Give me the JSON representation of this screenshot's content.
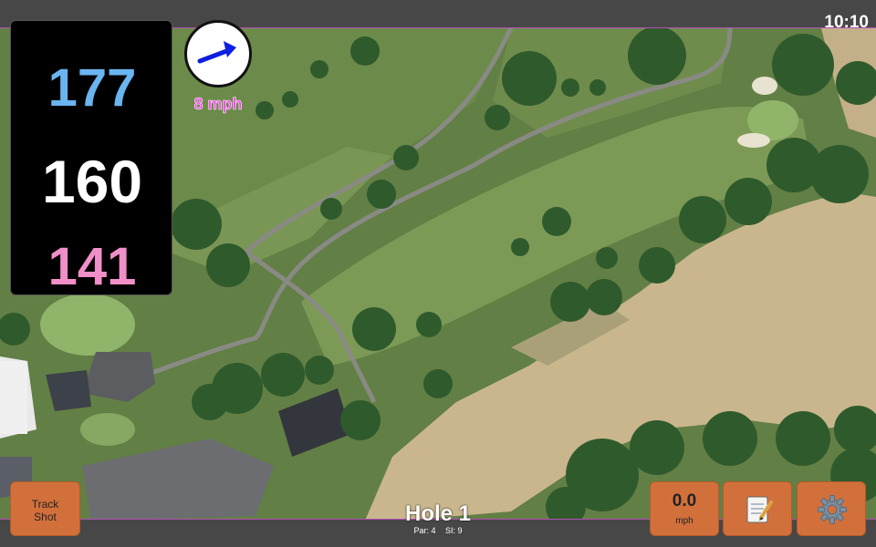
{
  "status": {
    "time": "10:10"
  },
  "distances": {
    "back": "177",
    "center": "160",
    "front": "141"
  },
  "wind": {
    "speed_label": "8 mph",
    "direction": "east-northeast",
    "icon": "arrow-icon"
  },
  "hole": {
    "title": "Hole 1",
    "par_label": "Par: 4",
    "si_label": "SI: 9"
  },
  "buttons": {
    "track_shot_label_1": "Track",
    "track_shot_label_2": "Shot",
    "speed_value": "0.0",
    "speed_unit": "mph",
    "notes_icon": "notepad-icon",
    "settings_icon": "gear-icon"
  },
  "colors": {
    "button": "#d2703c",
    "back_distance": "#6ab4f0",
    "center_distance": "#ffffff",
    "front_distance": "#f08fc8",
    "wind_label": "#ff3df0"
  }
}
